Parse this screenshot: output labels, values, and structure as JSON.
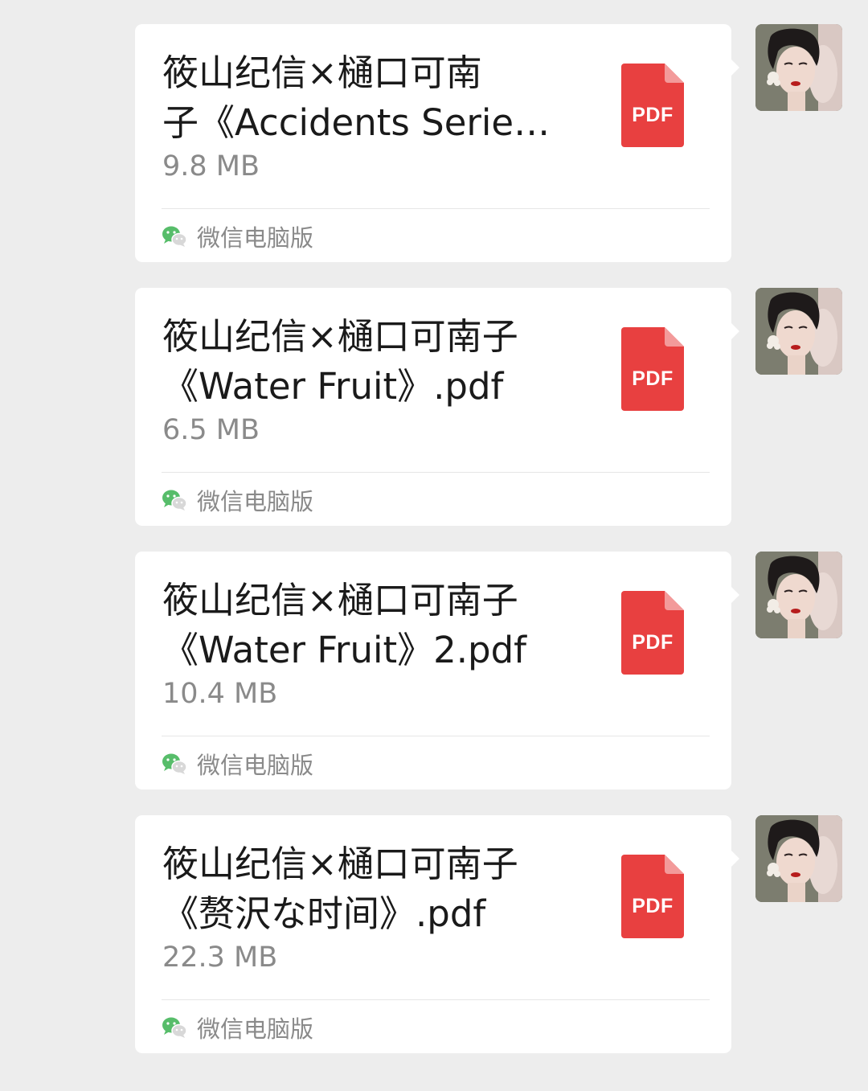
{
  "messages": [
    {
      "title_line1": "筱山纪信×樋口可南",
      "title_line2": "子《Accidents Series ...",
      "file_size": "9.8 MB",
      "file_type": "PDF",
      "source": "微信电脑版"
    },
    {
      "title_line1": "筱山纪信×樋口可南子",
      "title_line2": "《Water Fruit》.pdf",
      "file_size": "6.5 MB",
      "file_type": "PDF",
      "source": "微信电脑版"
    },
    {
      "title_line1": "筱山纪信×樋口可南子",
      "title_line2": "《Water Fruit》2.pdf",
      "file_size": "10.4 MB",
      "file_type": "PDF",
      "source": "微信电脑版"
    },
    {
      "title_line1": "筱山纪信×樋口可南子",
      "title_line2": "《赘沢な时间》.pdf",
      "file_size": "22.3 MB",
      "file_type": "PDF",
      "source": "微信电脑版"
    }
  ],
  "colors": {
    "background": "#ededed",
    "bubble": "#ffffff",
    "pdf_red": "#e84040",
    "pdf_fold": "#f39a9a",
    "wechat_green": "#57bd6a",
    "secondary_text": "#8a8a8a"
  },
  "icons": {
    "file_icon": "pdf-file-icon",
    "source_icon": "wechat-logo-icon",
    "sender_avatar": "user-avatar"
  }
}
